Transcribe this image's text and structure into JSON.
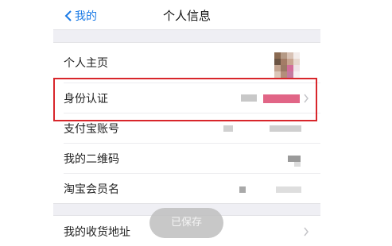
{
  "nav": {
    "back_label": "我的",
    "title": "个人信息"
  },
  "rows": [
    {
      "label": "个人主页"
    },
    {
      "label": "身份认证"
    },
    {
      "label": "支付宝账号"
    },
    {
      "label": "我的二维码"
    },
    {
      "label": "淘宝会员名"
    }
  ],
  "address_row": {
    "label": "我的收货地址"
  },
  "toast": {
    "text": "已保存"
  },
  "colors": {
    "accent": "#1a7ae6",
    "highlight_border": "#d8262b",
    "background": "#efeff4"
  },
  "icons": {
    "back": "chevron-left-icon",
    "row_arrow": "chevron-right-icon"
  }
}
